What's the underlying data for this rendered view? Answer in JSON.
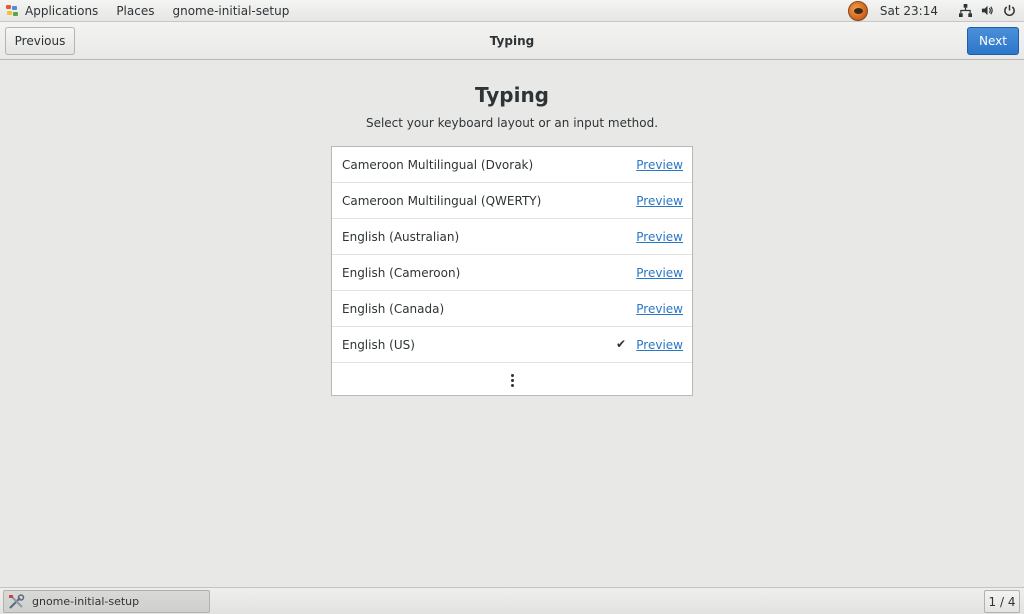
{
  "top_panel": {
    "applications_label": "Applications",
    "places_label": "Places",
    "app_name": "gnome-initial-setup",
    "clock": "Sat 23:14",
    "icons": [
      "weather-icon",
      "network-icon",
      "volume-icon",
      "power-icon"
    ]
  },
  "header": {
    "title": "Typing",
    "previous_label": "Previous",
    "next_label": "Next"
  },
  "main": {
    "title": "Typing",
    "subtitle": "Select your keyboard layout or an input method.",
    "layouts": [
      {
        "name": "Cameroon Multilingual (Dvorak)",
        "preview": "Preview",
        "selected": false
      },
      {
        "name": "Cameroon Multilingual (QWERTY)",
        "preview": "Preview",
        "selected": false
      },
      {
        "name": "English (Australian)",
        "preview": "Preview",
        "selected": false
      },
      {
        "name": "English (Cameroon)",
        "preview": "Preview",
        "selected": false
      },
      {
        "name": "English (Canada)",
        "preview": "Preview",
        "selected": false
      },
      {
        "name": "English (US)",
        "preview": "Preview",
        "selected": true
      }
    ],
    "check_glyph": "✔",
    "more_icon": "more-vertical-icon"
  },
  "bottom_panel": {
    "task_label": "gnome-initial-setup",
    "workspace": "1 / 4"
  },
  "colors": {
    "accent": "#2d76c9",
    "link": "#2a76c6",
    "background": "#e8e8e7"
  }
}
